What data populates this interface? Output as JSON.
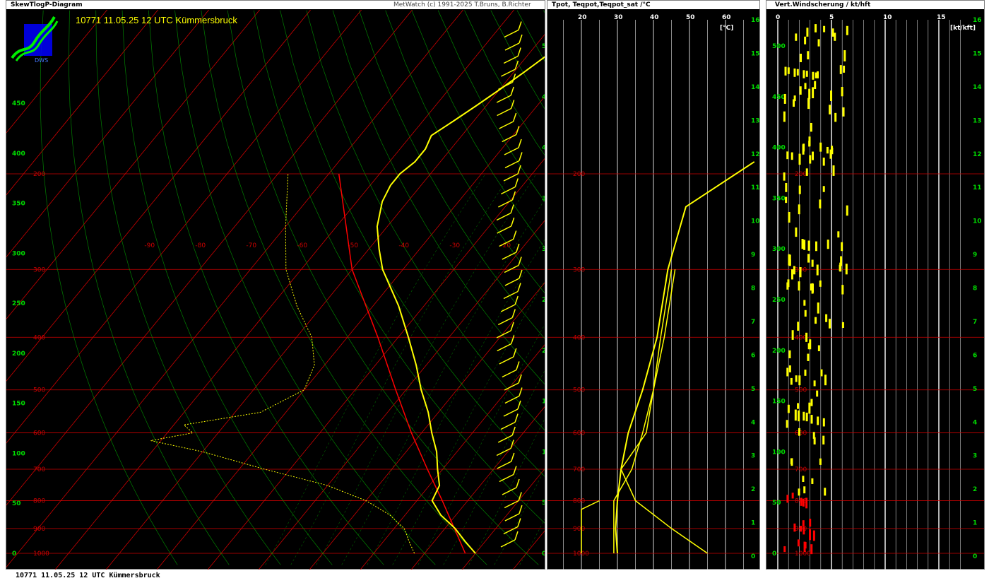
{
  "skewt": {
    "header_left": "SkewTlogP-Diagram",
    "header_right": "MetWatch  (c) 1991-2025 T.Bruns, B.Richter",
    "title": "10771 11.05.25 12 UTC Kümmersbruck",
    "logo_text": "DWS"
  },
  "theta": {
    "header": "Tpot, Teqpot,Teqpot_sat /°C",
    "unit": "[°C]"
  },
  "shear": {
    "header": "Vert.Windscherung / kt/hft",
    "unit": "[kt/kft]"
  },
  "footer": "10771 11.05.25 12 UTC Kümmersbruck",
  "colors": {
    "background": "#000000",
    "isotherm": "#cc0000",
    "dry_adiabat": "#00a000",
    "moist_adiabat": "#00a000",
    "temperature": "#ffff00",
    "dewpoint": "#ffff00",
    "parcel": "#ff0000",
    "axis_labels": "#00dd00"
  },
  "chart_data": [
    {
      "type": "line",
      "name": "skewt",
      "pressure_levels": [
        1000,
        900,
        800,
        700,
        600,
        500,
        400,
        300,
        200
      ],
      "isotherm_labels": [
        -90,
        -80,
        -70,
        -60,
        -50,
        -40,
        -30,
        -20,
        -10
      ],
      "height_hft_left": [
        0,
        50,
        100,
        150,
        200,
        250,
        300,
        350,
        400,
        450
      ],
      "height_hft_right": [
        0,
        50,
        100,
        150,
        200,
        250,
        300,
        350,
        400,
        450,
        500
      ],
      "temperature": {
        "p": [
          1000,
          950,
          900,
          850,
          800,
          750,
          700,
          650,
          600,
          550,
          500,
          450,
          400,
          350,
          300,
          275,
          250,
          225,
          210,
          200,
          190,
          180,
          170,
          160,
          150,
          140,
          130,
          120
        ],
        "t": [
          20,
          16,
          12,
          7,
          3,
          2,
          -1,
          -4,
          -8,
          -12,
          -17,
          -22,
          -28,
          -35,
          -44,
          -48,
          -52,
          -55,
          -56,
          -56,
          -55,
          -55,
          -56,
          -54,
          -52,
          -50,
          -48,
          -46
        ]
      },
      "dewpoint": {
        "p": [
          1000,
          950,
          900,
          850,
          800,
          750,
          700,
          650,
          620,
          600,
          580,
          550,
          500,
          450,
          400,
          350,
          300,
          250,
          200
        ],
        "td": [
          8,
          5,
          2,
          -3,
          -10,
          -20,
          -35,
          -50,
          -62,
          -55,
          -58,
          -45,
          -40,
          -42,
          -47,
          -55,
          -63,
          -70,
          -78
        ]
      },
      "parcel": {
        "p": [
          1000,
          800,
          700,
          600,
          500,
          400,
          300,
          200
        ],
        "t": [
          18,
          5,
          -3,
          -12,
          -22,
          -34,
          -50,
          -68
        ]
      }
    },
    {
      "type": "line",
      "name": "theta_profile",
      "x_ticks": [
        20,
        30,
        40,
        50,
        60
      ],
      "pressure_levels": [
        1000,
        900,
        800,
        700,
        600,
        500,
        400,
        300,
        200
      ],
      "height_km": [
        0,
        1,
        2,
        3,
        4,
        5,
        6,
        7,
        8,
        9,
        10,
        11,
        12,
        13,
        14,
        15,
        16
      ]
    },
    {
      "type": "scatter",
      "name": "wind_shear",
      "x_ticks": [
        0,
        5,
        10,
        15
      ],
      "pressure_levels": [
        1000,
        900,
        800,
        700,
        600,
        500,
        400,
        300,
        200
      ],
      "height_km": [
        0,
        1,
        2,
        3,
        4,
        5,
        6,
        7,
        8,
        9,
        10,
        11,
        12,
        13,
        14,
        15,
        16
      ],
      "height_hft": [
        0,
        50,
        100,
        150,
        200,
        250,
        300,
        350,
        400,
        450,
        500
      ]
    }
  ]
}
